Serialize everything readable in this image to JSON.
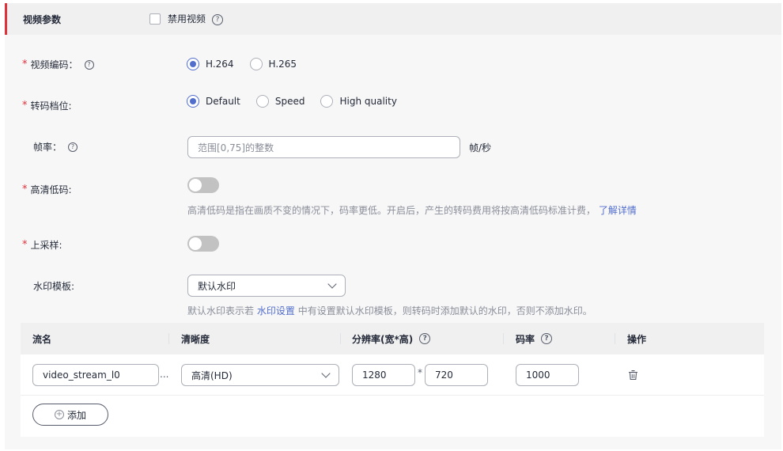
{
  "section": {
    "title": "视频参数",
    "disable_video_label": "禁用视频"
  },
  "video_codec": {
    "label": "视频编码：",
    "options": [
      "H.264",
      "H.265"
    ],
    "selected": "H.264"
  },
  "transcode_level": {
    "label": "转码档位:",
    "options": [
      "Default",
      "Speed",
      "High quality"
    ],
    "selected": "Default"
  },
  "frame_rate": {
    "label": "帧率：",
    "placeholder": "范围[0,75]的整数",
    "unit": "帧/秒"
  },
  "hd_low_bitrate": {
    "label": "高清低码:",
    "enabled": false,
    "hint": "高清低码是指在画质不变的情况下，码率更低。开启后，产生的转码费用将按高清低码标准计费，",
    "hint_link": "了解详情"
  },
  "upsampling": {
    "label": "上采样:",
    "enabled": false
  },
  "watermark": {
    "label": "水印模板:",
    "selected": "默认水印",
    "hint_prefix": "默认水印表示若",
    "hint_link": "水印设置",
    "hint_suffix": "中有设置默认水印模板，则转码时添加默认的水印，否则不添加水印。"
  },
  "table": {
    "headers": {
      "name": "流名",
      "clarity": "清晰度",
      "resolution": "分辨率(宽*高)",
      "bitrate": "码率",
      "actions": "操作"
    },
    "rows": [
      {
        "name": "video_stream_l0",
        "clarity": "高清(HD)",
        "width": "1280",
        "height": "720",
        "bitrate": "1000"
      }
    ],
    "add_label": "添加"
  },
  "icons": {
    "help": "question-circle-icon",
    "trash": "trash-icon",
    "plus": "plus-circle-icon",
    "chevron": "chevron-down-icon"
  },
  "colors": {
    "accent": "#526ecc",
    "required": "#e0323c",
    "section_bar": "#e0323c"
  }
}
